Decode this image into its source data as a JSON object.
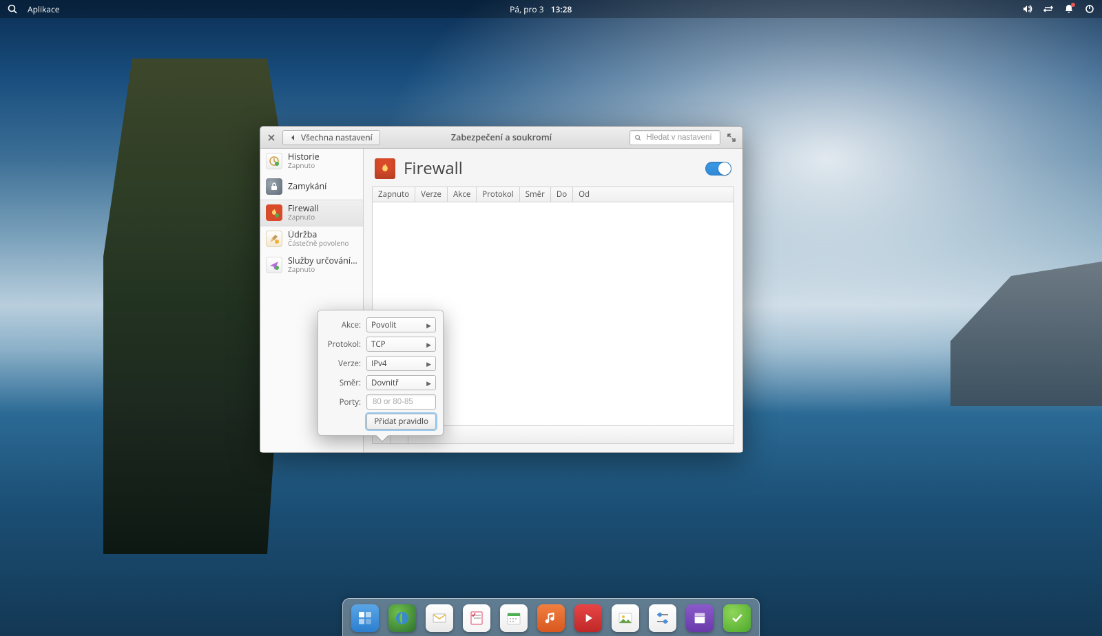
{
  "top_panel": {
    "applications": "Aplikace",
    "date": "Pá, pro 3",
    "time": "13:28"
  },
  "window": {
    "back_label": "Všechna nastavení",
    "title": "Zabezpečení a soukromí",
    "search_placeholder": "Hledat v nastavení"
  },
  "sidebar": {
    "items": [
      {
        "label": "Historie",
        "sub": "Zapnuto"
      },
      {
        "label": "Zamykání",
        "sub": ""
      },
      {
        "label": "Firewall",
        "sub": "Zapnuto"
      },
      {
        "label": "Údržba",
        "sub": "Částečně povoleno"
      },
      {
        "label": "Služby určování po…",
        "sub": "Zapnuto"
      }
    ]
  },
  "content": {
    "heading": "Firewall",
    "switch_on": true,
    "columns": [
      "Zapnuto",
      "Verze",
      "Akce",
      "Protokol",
      "Směr",
      "Do",
      "Od"
    ]
  },
  "popover": {
    "fields": {
      "akce": {
        "label": "Akce:",
        "value": "Povolit"
      },
      "protokol": {
        "label": "Protokol:",
        "value": "TCP"
      },
      "verze": {
        "label": "Verze:",
        "value": "IPv4"
      },
      "smer": {
        "label": "Směr:",
        "value": "Dovnitř"
      },
      "porty": {
        "label": "Porty:",
        "placeholder": "80 or 80-85",
        "value": ""
      }
    },
    "submit": "Přidat pravidlo"
  },
  "dock": {
    "items": [
      "multitasking",
      "web-browser",
      "mail",
      "tasks",
      "calendar",
      "music",
      "videos",
      "photos",
      "settings",
      "app-center",
      "updates"
    ]
  }
}
